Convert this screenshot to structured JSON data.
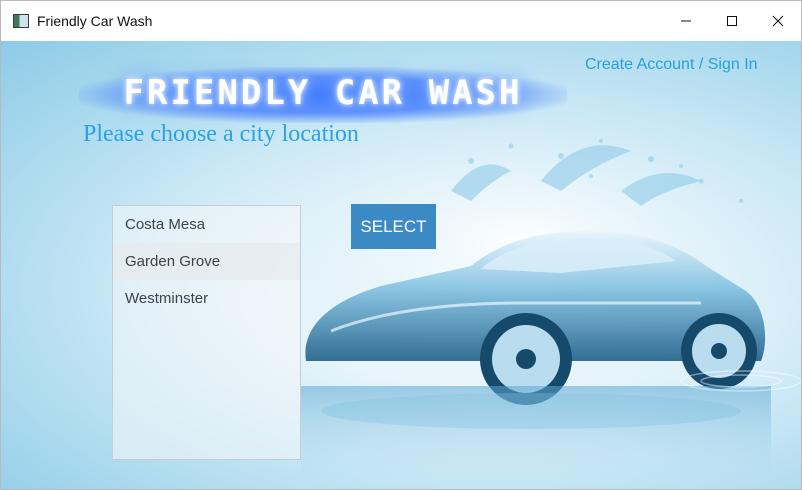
{
  "window": {
    "title": "Friendly Car Wash",
    "icon": "app-window-icon"
  },
  "header": {
    "logo_text": "FRIENDLY CAR WASH",
    "subtitle": "Please choose a city location",
    "account_link": "Create Account / Sign In"
  },
  "cities": {
    "items": [
      "Costa Mesa",
      "Garden Grove",
      "Westminster"
    ]
  },
  "actions": {
    "select_label": "SELECT"
  },
  "colors": {
    "accent_button": "#3c8ac4",
    "link": "#2a9fd8",
    "subtitle": "#2aa3e6",
    "logo_glow": "#3f6fff"
  }
}
